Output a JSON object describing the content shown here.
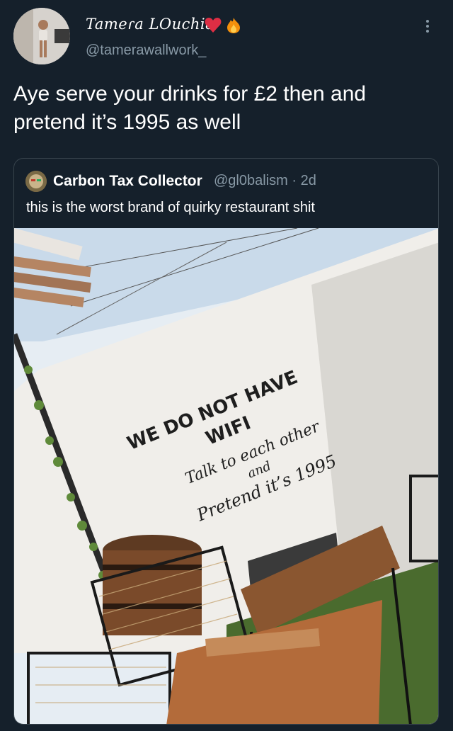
{
  "tweet": {
    "display_name": "Tameɾa LOuchia",
    "handle": "@tamerawallwork_",
    "text": "Aye serve your drinks for £2 then and pretend it’s 1995 as well"
  },
  "quoted_tweet": {
    "display_name": "Carbon Tax Collector",
    "handle": "@gl0balism",
    "separator": "·",
    "age": "2d",
    "text": "this is the worst brand of quirky restaurant shit",
    "photo": {
      "sign_line_1": "WE DO NOT HAVE",
      "sign_line_2": "WIFI",
      "sign_line_3": "Talk to each other",
      "sign_line_4": "and",
      "sign_line_5": "Pretend it’s 1995"
    }
  },
  "icons": [
    "heart-emoji",
    "fire-emoji",
    "more-options-icon"
  ],
  "colors": {
    "background": "#15202b",
    "secondary_text": "#8899a6",
    "border": "#38444d"
  }
}
